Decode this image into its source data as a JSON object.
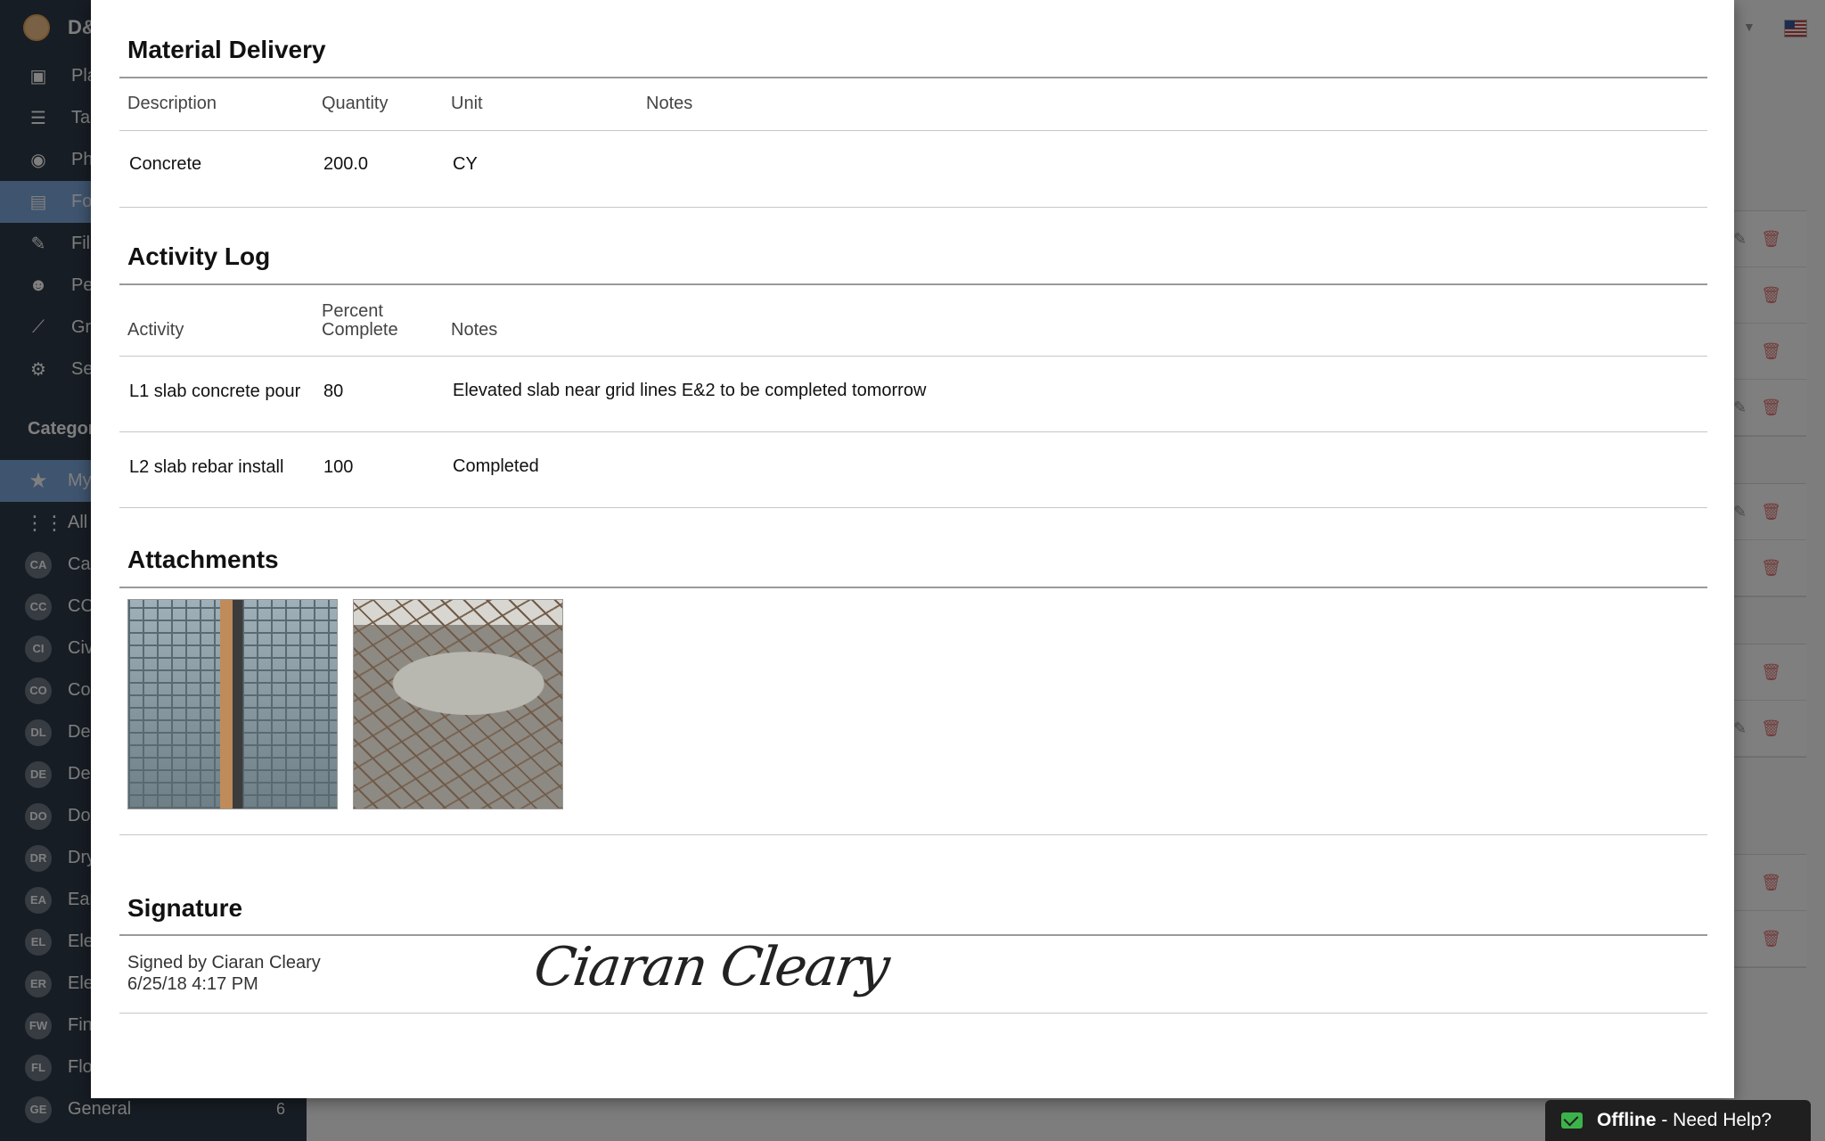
{
  "app": {
    "brand": "D&",
    "nav": [
      {
        "label": "Pla",
        "icon": "plans-icon",
        "glyph": "▣"
      },
      {
        "label": "Tas",
        "icon": "tasks-icon",
        "glyph": "☰"
      },
      {
        "label": "Pho",
        "icon": "camera-icon",
        "glyph": "◉"
      },
      {
        "label": "For",
        "icon": "forms-icon",
        "glyph": "▤",
        "active": true
      },
      {
        "label": "File",
        "icon": "paperclip-icon",
        "glyph": "✎"
      },
      {
        "label": "Peo",
        "icon": "people-icon",
        "glyph": "☻"
      },
      {
        "label": "Gra",
        "icon": "graph-icon",
        "glyph": "⟋"
      },
      {
        "label": "Set",
        "icon": "gear-icon",
        "glyph": "⚙"
      }
    ],
    "categories_heading": "Categor",
    "categories": [
      {
        "badge": "★",
        "label": "My",
        "type": "star",
        "active": true
      },
      {
        "badge": "⋮⋮",
        "label": "All",
        "type": "grid"
      },
      {
        "badge": "CA",
        "label": "Ca"
      },
      {
        "badge": "CC",
        "label": "CC"
      },
      {
        "badge": "CI",
        "label": "Civ"
      },
      {
        "badge": "CO",
        "label": "Co"
      },
      {
        "badge": "DL",
        "label": "De"
      },
      {
        "badge": "DE",
        "label": "De"
      },
      {
        "badge": "DO",
        "label": "Do"
      },
      {
        "badge": "DR",
        "label": "Dry"
      },
      {
        "badge": "EA",
        "label": "Ear"
      },
      {
        "badge": "EL",
        "label": "Ele"
      },
      {
        "badge": "ER",
        "label": "Ele"
      },
      {
        "badge": "FW",
        "label": "Fin"
      },
      {
        "badge": "FL",
        "label": "Flo"
      },
      {
        "badge": "GE",
        "label": "General",
        "count": "6"
      }
    ]
  },
  "report": {
    "material": {
      "title": "Material Delivery",
      "columns": [
        "Description",
        "Quantity",
        "Unit",
        "Notes"
      ],
      "rows": [
        {
          "description": "Concrete",
          "quantity": "200.0",
          "unit": "CY",
          "notes": ""
        }
      ]
    },
    "activity": {
      "title": "Activity Log",
      "columns": [
        "Activity",
        "Percent",
        "Complete",
        "Notes"
      ],
      "rows": [
        {
          "activity": "L1 slab concrete pour",
          "percent": "80",
          "notes": "Elevated slab near grid lines E&2 to be completed tomorrow"
        },
        {
          "activity": "L2 slab rebar install",
          "percent": "100",
          "notes": "Completed"
        }
      ]
    },
    "attachments": {
      "title": "Attachments"
    },
    "signature": {
      "title": "Signature",
      "signed_by": "Signed by Ciaran Cleary",
      "timestamp": "6/25/18 4:17 PM",
      "signature_text": "Ciaran Cleary"
    }
  },
  "help_widget": {
    "status": "Offline",
    "separator": " - ",
    "text": "Need Help?"
  }
}
